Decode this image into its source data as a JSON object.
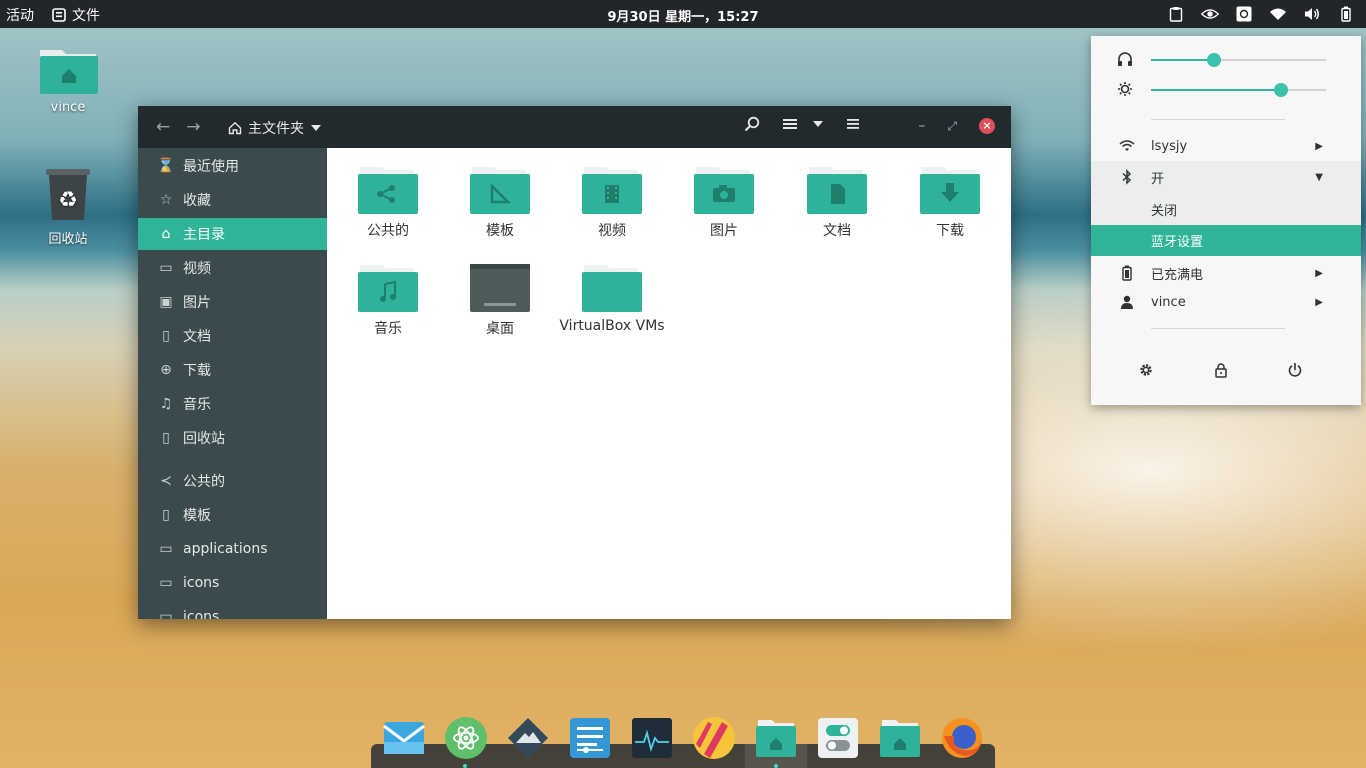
{
  "topbar": {
    "activities": "活动",
    "app_menu": "文件",
    "clock": "9月30日 星期一，15:27"
  },
  "desktop": {
    "home_label": "vince",
    "trash_label": "回收站"
  },
  "window": {
    "path_label": "主文件夹",
    "sidebar": [
      {
        "label": "最近使用",
        "icon": "clock-icon"
      },
      {
        "label": "收藏",
        "icon": "star-icon"
      },
      {
        "label": "主目录",
        "icon": "home-icon",
        "active": true
      },
      {
        "label": "视频",
        "icon": "video-icon"
      },
      {
        "label": "图片",
        "icon": "image-icon"
      },
      {
        "label": "文档",
        "icon": "document-icon"
      },
      {
        "label": "下载",
        "icon": "download-icon"
      },
      {
        "label": "音乐",
        "icon": "music-icon"
      },
      {
        "label": "回收站",
        "icon": "trash-icon"
      },
      {
        "label": "公共的",
        "icon": "share-icon"
      },
      {
        "label": "模板",
        "icon": "document-icon"
      },
      {
        "label": "applications",
        "icon": "folder-icon"
      },
      {
        "label": "icons",
        "icon": "folder-icon"
      },
      {
        "label": "icons",
        "icon": "folder-icon"
      }
    ],
    "files": [
      {
        "label": "公共的",
        "emblem": "share"
      },
      {
        "label": "模板",
        "emblem": "template"
      },
      {
        "label": "视频",
        "emblem": "video"
      },
      {
        "label": "图片",
        "emblem": "camera"
      },
      {
        "label": "文档",
        "emblem": "document"
      },
      {
        "label": "下载",
        "emblem": "download"
      },
      {
        "label": "音乐",
        "emblem": "music"
      },
      {
        "label": "桌面",
        "emblem": "desktop"
      },
      {
        "label": "VirtualBox VMs",
        "emblem": "none"
      }
    ]
  },
  "popup": {
    "volume_level": 0.36,
    "brightness_level": 0.74,
    "wifi_label": "lsysjy",
    "bluetooth_label": "开",
    "bluetooth_off": "关闭",
    "bluetooth_settings": "蓝牙设置",
    "battery_label": "已充满电",
    "user_label": "vince"
  },
  "colors": {
    "accent": "#30b498",
    "folder": "#2fb29a",
    "sidebar_bg": "#3b4a4d",
    "headerbar_bg": "#232a2e"
  }
}
